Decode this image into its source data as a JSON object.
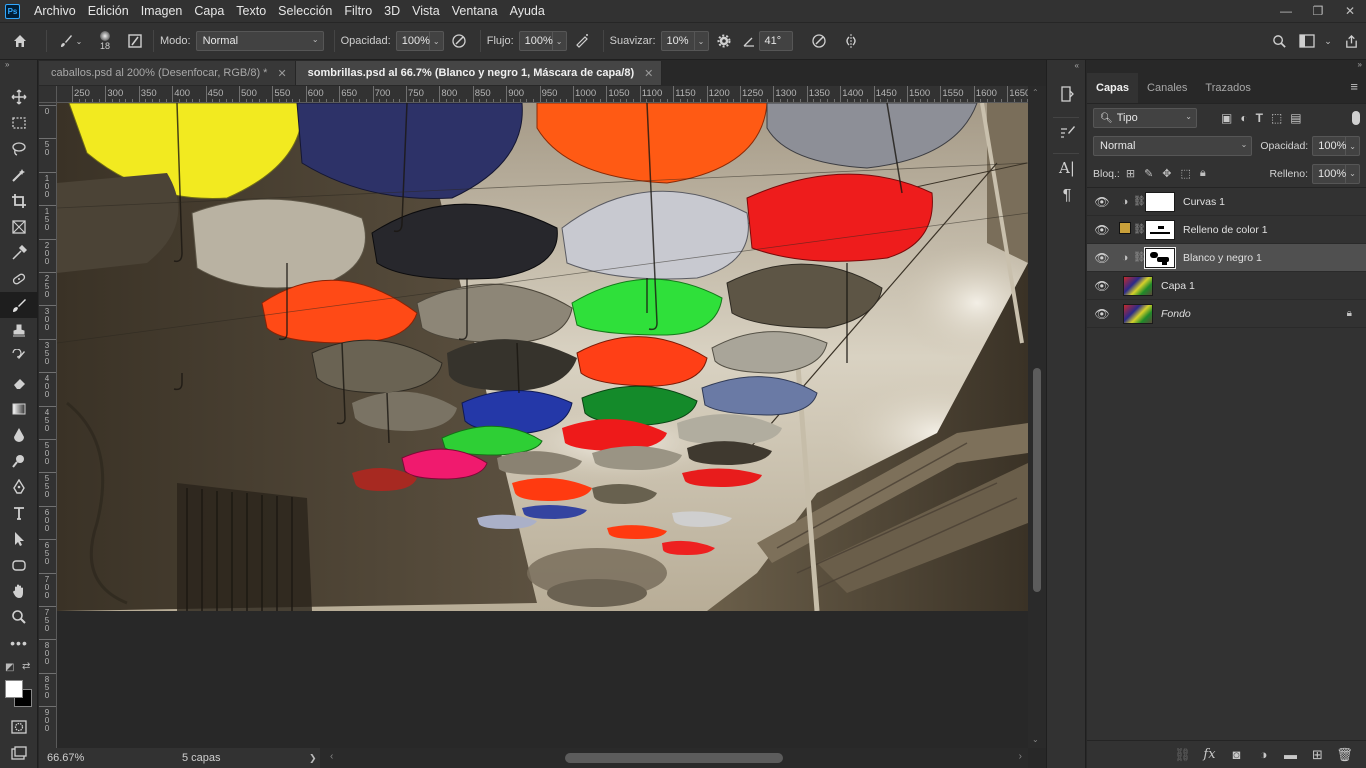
{
  "app": {
    "logo_text": "Ps"
  },
  "menu": [
    "Archivo",
    "Edición",
    "Imagen",
    "Capa",
    "Texto",
    "Selección",
    "Filtro",
    "3D",
    "Vista",
    "Ventana",
    "Ayuda"
  ],
  "window_controls": {
    "minimize": "—",
    "restore": "❐",
    "close": "✕"
  },
  "options": {
    "brush_size": "18",
    "mode_label": "Modo:",
    "mode_value": "Normal",
    "opacity_label": "Opacidad:",
    "opacity_value": "100%",
    "flow_label": "Flujo:",
    "flow_value": "100%",
    "smooth_label": "Suavizar:",
    "smooth_value": "10%",
    "angle_value": "41°"
  },
  "tabs": [
    {
      "label": "caballos.psd al 200% (Desenfocar, RGB/8) *",
      "active": false
    },
    {
      "label": "sombrillas.psd al 66.7% (Blanco y negro 1, Máscara de capa/8)",
      "active": true
    }
  ],
  "ruler_h": [
    "250",
    "300",
    "350",
    "400",
    "450",
    "500",
    "550",
    "600",
    "650",
    "700",
    "750",
    "800",
    "850",
    "900",
    "950",
    "1000",
    "1050",
    "1100",
    "1150",
    "1200",
    "1250",
    "1300",
    "1350",
    "1400",
    "1450",
    "1500",
    "1550",
    "1600",
    "1650"
  ],
  "ruler_v": [
    [
      "0"
    ],
    [
      "5",
      "0"
    ],
    [
      "1",
      "0",
      "0"
    ],
    [
      "1",
      "5",
      "0"
    ],
    [
      "2",
      "0",
      "0"
    ],
    [
      "2",
      "5",
      "0"
    ],
    [
      "3",
      "0",
      "0"
    ],
    [
      "3",
      "5",
      "0"
    ],
    [
      "4",
      "0",
      "0"
    ],
    [
      "4",
      "5",
      "0"
    ],
    [
      "5",
      "0",
      "0"
    ],
    [
      "5",
      "5",
      "0"
    ],
    [
      "6",
      "0",
      "0"
    ],
    [
      "6",
      "5",
      "0"
    ],
    [
      "7",
      "0",
      "0"
    ],
    [
      "7",
      "5",
      "0"
    ],
    [
      "8",
      "0",
      "0"
    ],
    [
      "8",
      "5",
      "0"
    ],
    [
      "9",
      "0",
      "0"
    ]
  ],
  "status": {
    "zoom": "66.67%",
    "info": "5 capas",
    "arrow": "❯"
  },
  "panel": {
    "tabs": [
      "Capas",
      "Canales",
      "Trazados"
    ],
    "filter_value": "Tipo",
    "blend_mode": "Normal",
    "opacity_label": "Opacidad:",
    "opacity_value": "100%",
    "lock_label": "Bloq.:",
    "fill_label": "Relleno:",
    "fill_value": "100%",
    "layers": [
      {
        "name": "Curvas 1",
        "italic": false
      },
      {
        "name": "Relleno de color 1",
        "italic": false
      },
      {
        "name": "Blanco y negro 1",
        "italic": false
      },
      {
        "name": "Capa 1",
        "italic": false
      },
      {
        "name": "Fondo",
        "italic": true
      }
    ]
  },
  "colors": {
    "fill_swatch": "#c9a03a"
  }
}
